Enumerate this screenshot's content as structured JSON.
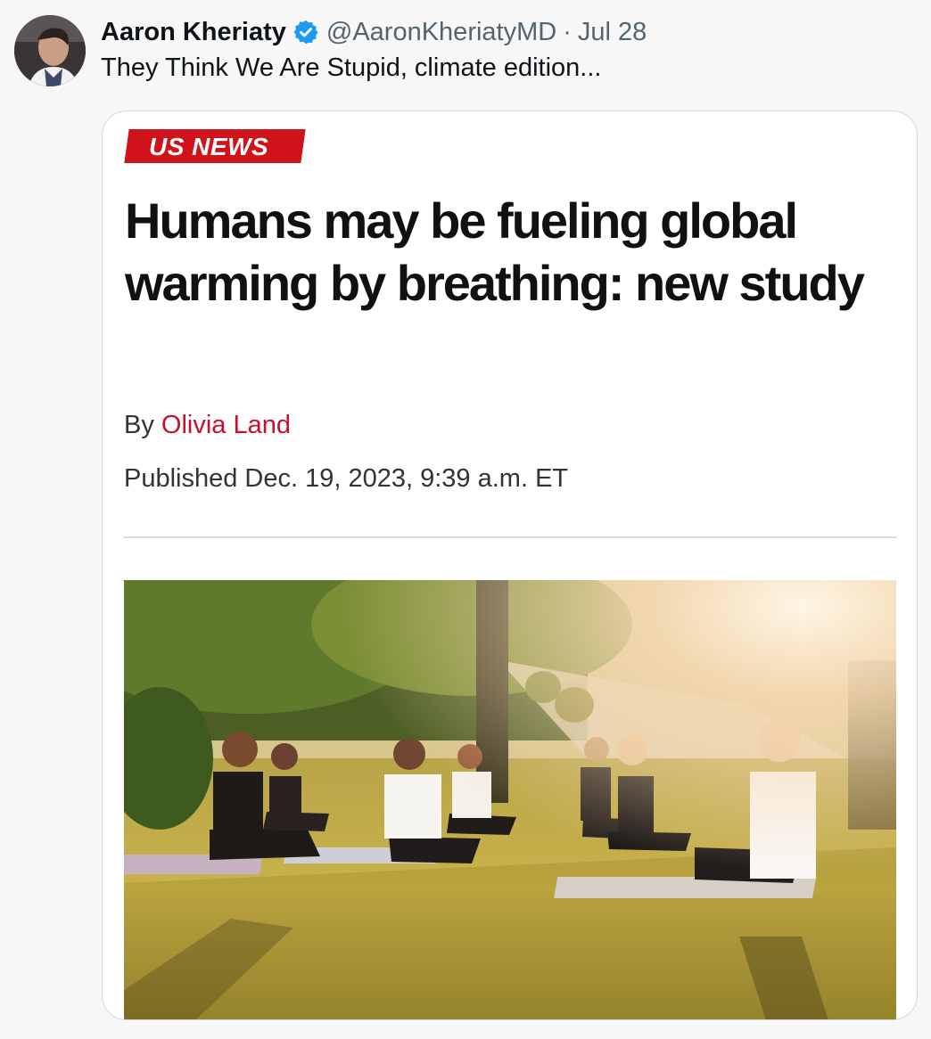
{
  "tweet": {
    "author_name": "Aaron Kheriaty",
    "handle": "@AaronKheriatyMD",
    "separator": "·",
    "date": "Jul 28",
    "text": "They Think We Are Stupid, climate edition..."
  },
  "card": {
    "section_label": "US NEWS",
    "headline": "Humans may be fueling global warming by breathing: new study",
    "byline_prefix": "By",
    "byline_author": "Olivia Land",
    "published": "Published Dec. 19, 2023, 9:39 a.m. ET"
  },
  "icons": {
    "verified": "verified-badge-icon"
  },
  "colors": {
    "verified_blue": "#1d9bf0",
    "section_red": "#d0121b",
    "author_link_red": "#c8102e"
  }
}
